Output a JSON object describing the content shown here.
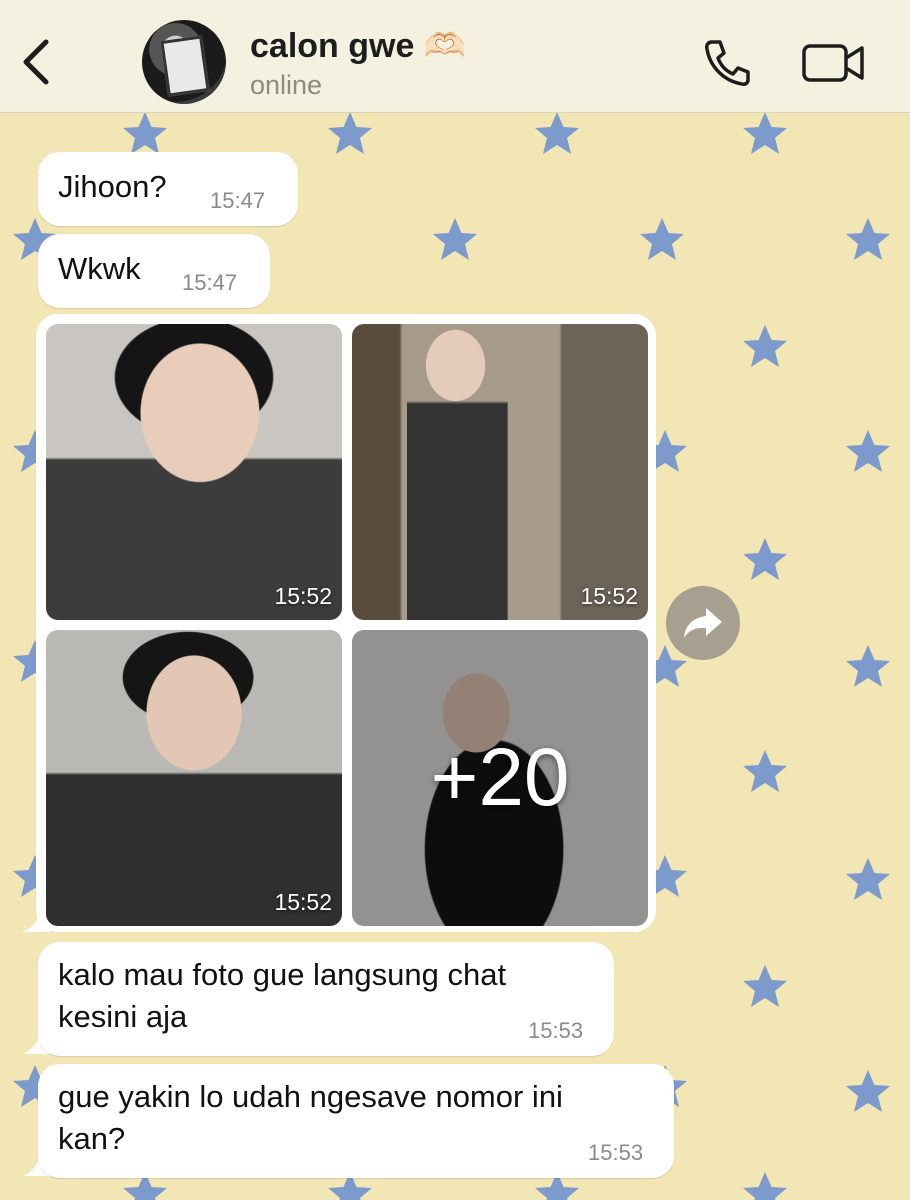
{
  "header": {
    "contact_name": "calon gwe 🫶🏻",
    "status": "online"
  },
  "messages": [
    {
      "text": "Jihoon?",
      "time": "15:47"
    },
    {
      "text": "Wkwk",
      "time": "15:47"
    },
    {
      "text": "kalo mau foto gue langsung chat\nkesini aja",
      "time": "15:53"
    },
    {
      "text": "gue yakin lo udah ngesave nomor ini\nkan?",
      "time": "15:53"
    }
  ],
  "media": {
    "photos": [
      {
        "time": "15:52"
      },
      {
        "time": "15:52"
      },
      {
        "time": "15:52"
      },
      {
        "overlay": "+20"
      }
    ]
  },
  "colors": {
    "wallpaper": "#f2e6b4",
    "star": "#7c9acb",
    "bubble": "#ffffff",
    "header": "#f5f1e1"
  },
  "icons": [
    "back-icon",
    "phone-icon",
    "video-call-icon",
    "forward-icon",
    "star-pattern"
  ]
}
